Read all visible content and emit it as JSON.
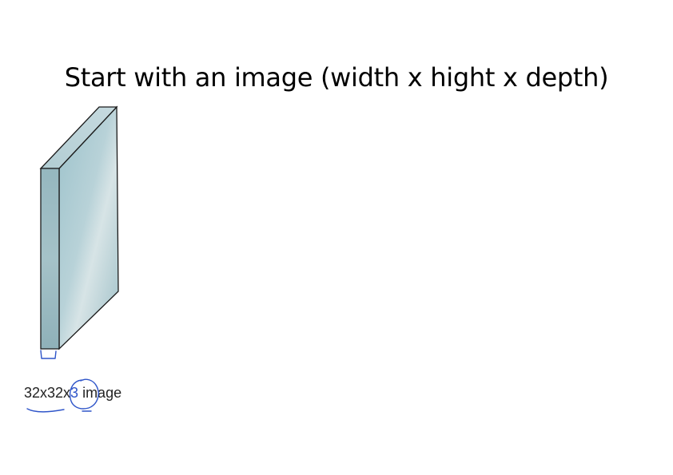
{
  "slide": {
    "title": "Start with an image (width x hight x depth)"
  },
  "caption": {
    "width_height": "32x32x",
    "depth": "3",
    "suffix": " image"
  },
  "colors": {
    "volume_face": "#a9c8cf",
    "volume_side": "#8fb2ba",
    "volume_top": "#b9d3d8",
    "volume_outline": "#1a1a1a",
    "annotation_ink": "#2f55c9",
    "title_text": "#000000"
  }
}
